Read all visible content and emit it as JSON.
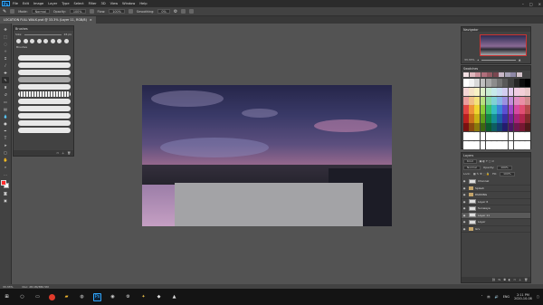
{
  "menubar": {
    "logo": "Ps",
    "items": [
      "File",
      "Edit",
      "Image",
      "Layer",
      "Type",
      "Select",
      "Filter",
      "3D",
      "View",
      "Window",
      "Help"
    ]
  },
  "options": {
    "mode_label": "Mode:",
    "mode_value": "Normal",
    "opacity_label": "Opacity:",
    "opacity_value": "100%",
    "flow_label": "Flow:",
    "flow_value": "100%",
    "smoothing_label": "Smoothing:",
    "smoothing_value": "0%"
  },
  "doc_tab": {
    "title": "LOCATION FULL WALK.psd @ 33.3% (Layer 11, RGB/8)",
    "close": "×"
  },
  "brushes_panel": {
    "title": "Brushes",
    "size_label": "Size:",
    "size_value": "26 px",
    "group_label": "Brushes"
  },
  "navigator": {
    "title": "Navigator",
    "zoom": "33.33%"
  },
  "swatches": {
    "title": "Swatches",
    "colors": [
      "#ffffff",
      "#f2f2f2",
      "#d9d9d9",
      "#bfbfbf",
      "#a6a6a6",
      "#8c8c8c",
      "#737373",
      "#595959",
      "#404040",
      "#262626",
      "#0d0d0d",
      "#000000",
      "#f4d6d6",
      "#f6e3c8",
      "#f8f1c4",
      "#dff0c8",
      "#c8ecd3",
      "#c7eaea",
      "#c9dcf2",
      "#d3cdf1",
      "#e4cdef",
      "#f0cde3",
      "#f3d0d8",
      "#e9c9c9",
      "#ea9d9d",
      "#f0bf86",
      "#f3e17c",
      "#b9e07f",
      "#85d7a2",
      "#80d2d4",
      "#86b3e6",
      "#9c8fe0",
      "#c38ddb",
      "#e08cc2",
      "#e98fa6",
      "#cf8c8c",
      "#e04545",
      "#ec9337",
      "#efd431",
      "#8ccc36",
      "#3abf6a",
      "#35bcc0",
      "#3b85d9",
      "#5d4fd1",
      "#a047c9",
      "#d64aa2",
      "#e04e73",
      "#b34a4a",
      "#b82020",
      "#c9701b",
      "#c9b114",
      "#5f9d19",
      "#148a45",
      "#148f93",
      "#1d5fa8",
      "#3a2ea3",
      "#75229b",
      "#a8237a",
      "#b3264e",
      "#7f2a2a",
      "#7a1111",
      "#8a4a10",
      "#8a790c",
      "#3d6710",
      "#0d5c2d",
      "#0d5e61",
      "#123f70",
      "#241c6d",
      "#4d1667",
      "#701651",
      "#771833",
      "#4f1a1a",
      "#ffffff",
      "#ffffff",
      "#ffffff",
      "#ffffff",
      "#ffffff",
      "#ffffff",
      "#ffffff",
      "#ffffff",
      "#ffffff",
      "#ffffff",
      "#ffffff",
      "#ffffff",
      "#ffffff",
      "#ffffff",
      "#ffffff",
      "#ffffff",
      "#ffffff",
      "#ffffff",
      "#ffffff",
      "#ffffff",
      "#ffffff",
      "#ffffff",
      "#ffffff",
      "#ffffff"
    ],
    "recent": [
      "#f2dfe2",
      "#e0b7bd",
      "#c98f98",
      "#b06f7c",
      "#935962",
      "#7a4750",
      "#c9b8c7",
      "#a7a2b6",
      "#8d87a5",
      "#d3c2ca"
    ]
  },
  "layers": {
    "title": "Layers",
    "kind": "Kind",
    "blend": "Normal",
    "opacity_label": "Opacity:",
    "opacity": "100%",
    "lock_label": "Lock:",
    "fill_label": "Fill:",
    "fill": "100%",
    "rows": [
      {
        "name": "Channel",
        "type": "thumb",
        "selected": false
      },
      {
        "name": "Splash",
        "type": "folder",
        "selected": false
      },
      {
        "name": "PARKING",
        "type": "folder",
        "selected": false
      },
      {
        "name": "Layer 6",
        "type": "thumb",
        "selected": false
      },
      {
        "name": "Sunwaya",
        "type": "thumb",
        "selected": false
      },
      {
        "name": "Layer 11",
        "type": "thumb",
        "selected": true
      },
      {
        "name": "Layer",
        "type": "thumb",
        "selected": false
      },
      {
        "name": "Grv",
        "type": "folder",
        "selected": false
      }
    ]
  },
  "status": {
    "zoom": "33.33%",
    "doc": "Doc: 28.1M/380.5M"
  },
  "taskbar": {
    "lang": "ENG",
    "time": "2:11 PM",
    "date": "2020-10-08"
  }
}
